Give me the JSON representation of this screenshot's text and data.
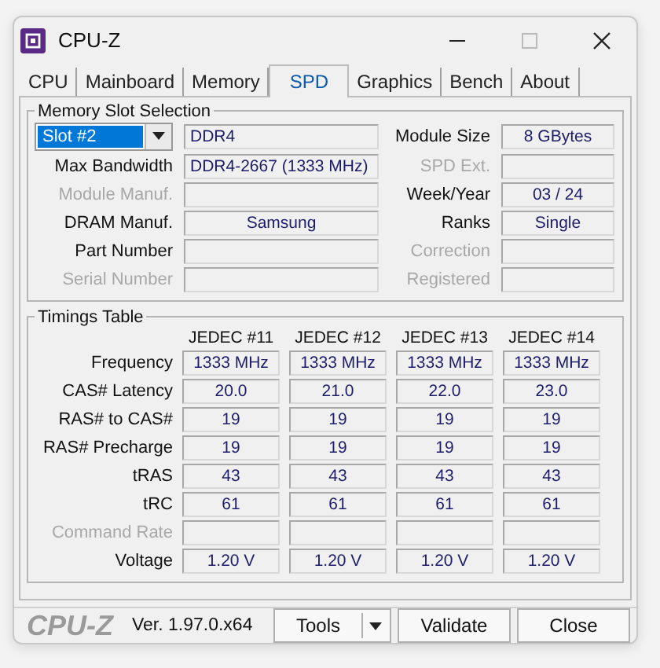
{
  "window": {
    "title": "CPU-Z"
  },
  "tabs": [
    {
      "label": "CPU",
      "selected": false
    },
    {
      "label": "Mainboard",
      "selected": false
    },
    {
      "label": "Memory",
      "selected": false
    },
    {
      "label": "SPD",
      "selected": true
    },
    {
      "label": "Graphics",
      "selected": false
    },
    {
      "label": "Bench",
      "selected": false
    },
    {
      "label": "About",
      "selected": false
    }
  ],
  "memory_slot_selection": {
    "title": "Memory Slot Selection",
    "slot": {
      "value": "Slot #2"
    },
    "memory_type": "DDR4",
    "left_fields": [
      {
        "label": "Max Bandwidth",
        "disabled": false,
        "value": "DDR4-2667 (1333 MHz)"
      },
      {
        "label": "Module Manuf.",
        "disabled": true
      },
      {
        "label": "DRAM Manuf.",
        "disabled": false,
        "value": "Samsung"
      },
      {
        "label": "Part Number",
        "disabled": false
      },
      {
        "label": "Serial Number",
        "disabled": true
      }
    ],
    "right_fields": [
      {
        "label": "Module Size",
        "disabled": false,
        "value": "8 GBytes"
      },
      {
        "label": "SPD Ext.",
        "disabled": true
      },
      {
        "label": "Week/Year",
        "disabled": false,
        "value": "03 / 24"
      },
      {
        "label": "Ranks",
        "disabled": false,
        "value": "Single"
      },
      {
        "label": "Correction",
        "disabled": true
      },
      {
        "label": "Registered",
        "disabled": true
      }
    ]
  },
  "timings_table": {
    "title": "Timings Table",
    "columns": [
      "JEDEC #11",
      "JEDEC #12",
      "JEDEC #13",
      "JEDEC #14"
    ],
    "rows": [
      {
        "label": "Frequency",
        "disabled": false,
        "values": [
          "1333 MHz",
          "1333 MHz",
          "1333 MHz",
          "1333 MHz"
        ]
      },
      {
        "label": "CAS# Latency",
        "disabled": false,
        "values": [
          "20.0",
          "21.0",
          "22.0",
          "23.0"
        ]
      },
      {
        "label": "RAS# to CAS#",
        "disabled": false,
        "values": [
          "19",
          "19",
          "19",
          "19"
        ]
      },
      {
        "label": "RAS# Precharge",
        "disabled": false,
        "values": [
          "19",
          "19",
          "19",
          "19"
        ]
      },
      {
        "label": "tRAS",
        "disabled": false,
        "values": [
          "43",
          "43",
          "43",
          "43"
        ]
      },
      {
        "label": "tRC",
        "disabled": false,
        "values": [
          "61",
          "61",
          "61",
          "61"
        ]
      },
      {
        "label": "Command Rate",
        "disabled": true
      },
      {
        "label": "Voltage",
        "disabled": false,
        "values": [
          "1.20 V",
          "1.20 V",
          "1.20 V",
          "1.20 V"
        ]
      }
    ]
  },
  "footer": {
    "logo": "CPU-Z",
    "version": "Ver. 1.97.0.x64",
    "buttons": [
      "Tools",
      "Validate",
      "Close"
    ]
  }
}
